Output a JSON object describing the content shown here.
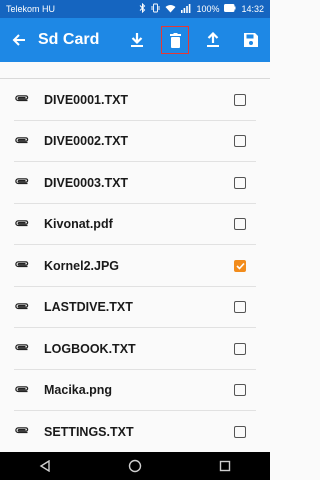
{
  "status": {
    "carrier": "Telekom HU",
    "battery": "100%",
    "time": "14:32",
    "icons": [
      "bluetooth-icon",
      "vibrate-icon",
      "wifi-icon",
      "signal-icon",
      "battery-icon"
    ]
  },
  "appbar": {
    "title": "Sd Card",
    "back_icon": "back-arrow-icon",
    "actions": [
      {
        "name": "download-icon"
      },
      {
        "name": "delete-icon",
        "selected": true
      },
      {
        "name": "upload-icon"
      },
      {
        "name": "save-icon"
      }
    ]
  },
  "files": [
    {
      "name": "DIVE0001.TXT",
      "checked": false
    },
    {
      "name": "DIVE0002.TXT",
      "checked": false
    },
    {
      "name": "DIVE0003.TXT",
      "checked": false
    },
    {
      "name": "Kivonat.pdf",
      "checked": false
    },
    {
      "name": "Kornel2.JPG",
      "checked": true
    },
    {
      "name": "LASTDIVE.TXT",
      "checked": false
    },
    {
      "name": "LOGBOOK.TXT",
      "checked": false
    },
    {
      "name": "Macika.png",
      "checked": false
    },
    {
      "name": "SETTINGS.TXT",
      "checked": false
    }
  ],
  "navbar": [
    "back-nav-icon",
    "home-nav-icon",
    "recents-nav-icon"
  ],
  "colors": {
    "statusbar": "#1565c0",
    "appbar": "#1e88e5",
    "checked": "#f28c1c",
    "highlight": "#e53935"
  }
}
